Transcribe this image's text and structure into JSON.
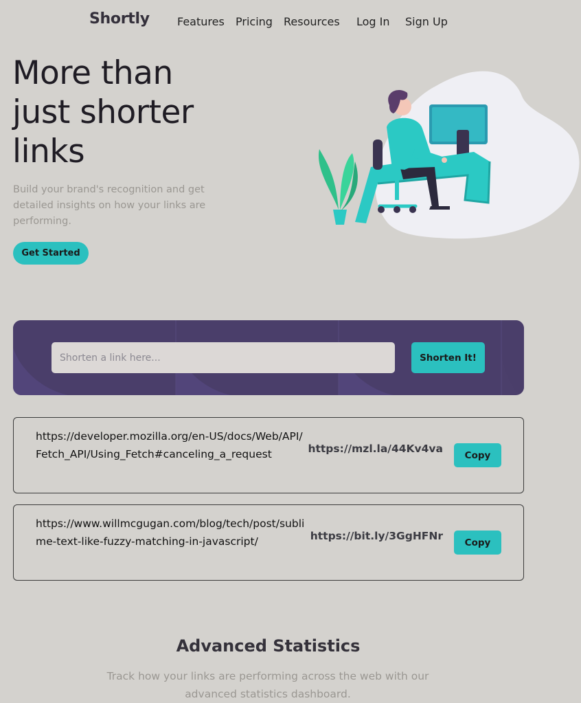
{
  "brand": {
    "logo": "Shortly",
    "accent_color": "#2bc0bf",
    "panel_color": "#4b3f6b"
  },
  "nav": {
    "links": [
      "Features",
      "Pricing",
      "Resources"
    ],
    "login": "Log In",
    "signup": "Sign Up"
  },
  "hero": {
    "title": "More than just shorter links",
    "description": "Build your brand's recognition and get detailed insights on how your links are performing.",
    "cta": "Get Started",
    "illustration": "person-working-at-desk-illustration"
  },
  "shorten": {
    "placeholder": "Shorten a link here...",
    "value": "",
    "button": "Shorten It!"
  },
  "results": [
    {
      "original": "https://developer.mozilla.org/en-US/docs/Web/API/Fetch_API/Using_Fetch#canceling_a_request",
      "short": "https://mzl.la/44Kv4va",
      "copy_label": "Copy"
    },
    {
      "original": "https://www.willmcgugan.com/blog/tech/post/sublime-text-like-fuzzy-matching-in-javascript/",
      "short": "https://bit.ly/3GgHFNr",
      "copy_label": "Copy"
    }
  ],
  "statistics": {
    "title": "Advanced Statistics",
    "description": "Track how your links are performing across the web with our advanced statistics dashboard."
  }
}
